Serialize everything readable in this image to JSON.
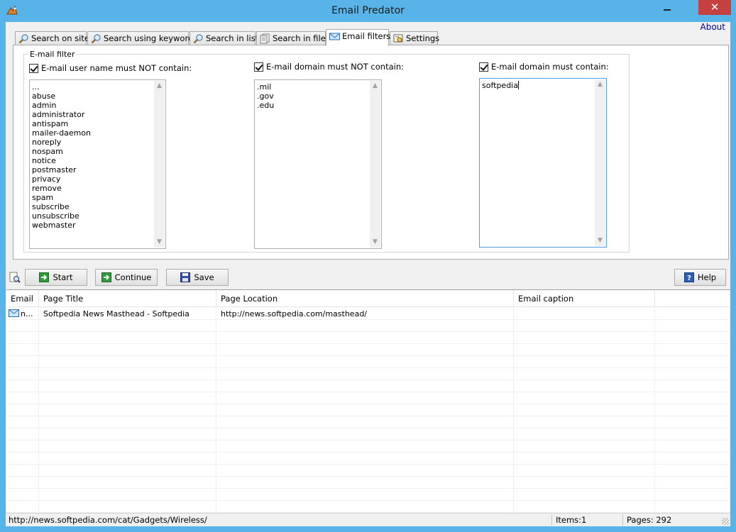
{
  "window": {
    "title": "Email Predator"
  },
  "menu": {
    "about": "About"
  },
  "tabs": [
    {
      "label": "Search on site",
      "icon": "magnifier-icon"
    },
    {
      "label": "Search using keywords",
      "icon": "magnifier-icon"
    },
    {
      "label": "Search in list",
      "icon": "magnifier-icon"
    },
    {
      "label": "Search in files",
      "icon": "document-icon"
    },
    {
      "label": "Email filters",
      "icon": "envelope-icon",
      "active": true
    },
    {
      "label": "Settings",
      "icon": "settings-icon"
    }
  ],
  "filters": {
    "group_label": "E-mail filter",
    "username_not": {
      "label": "E-mail user name must NOT contain:",
      "checked": true,
      "items": [
        "...",
        "abuse",
        "admin",
        "administrator",
        "antispam",
        "mailer-daemon",
        "noreply",
        "nospam",
        "notice",
        "postmaster",
        "privacy",
        "remove",
        "spam",
        "subscribe",
        "unsubscribe",
        "webmaster"
      ]
    },
    "domain_not": {
      "label": "E-mail domain must NOT contain:",
      "checked": true,
      "items": [
        ".mil",
        ".gov",
        ".edu"
      ]
    },
    "domain_must": {
      "label": "E-mail domain must  contain:",
      "checked": true,
      "items": [
        "softpedia"
      ]
    }
  },
  "toolbar": {
    "start": "Start",
    "continue": "Continue",
    "save": "Save",
    "help": "Help"
  },
  "grid": {
    "columns": [
      "Email",
      "Page Title",
      "Page Location",
      "Email caption"
    ],
    "rows": [
      {
        "email": "n...",
        "title": "Softpedia News Masthead - Softpedia",
        "location": "http://news.softpedia.com/masthead/",
        "caption": ""
      }
    ]
  },
  "status": {
    "url": "http://news.softpedia.com/cat/Gadgets/Wireless/",
    "items": "Items:1",
    "pages": "Pages: 292"
  },
  "colors": {
    "titlebar": "#58b4e8",
    "close_button": "#c74040",
    "focus_border": "#569de5"
  }
}
